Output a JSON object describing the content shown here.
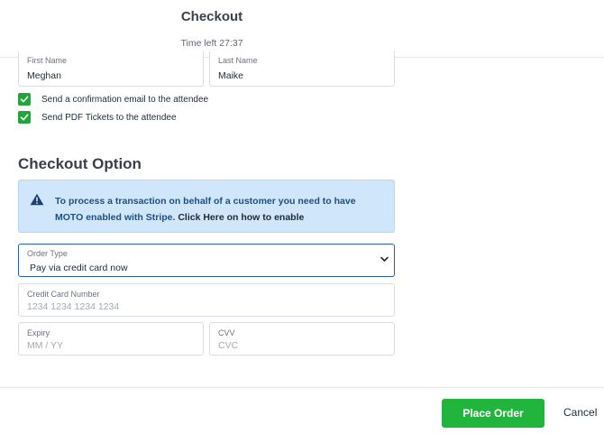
{
  "header": {
    "title": "Checkout",
    "timer": "Time left 27:37"
  },
  "attendee": {
    "first_name_label": "First Name",
    "first_name_value": "Meghan",
    "last_name_label": "Last Name",
    "last_name_value": "Maike",
    "options": [
      {
        "label": "Send a confirmation email to the attendee",
        "checked": true
      },
      {
        "label": "Send PDF Tickets to the attendee",
        "checked": true
      }
    ]
  },
  "checkout_option": {
    "section_title": "Checkout Option",
    "alert": {
      "text": "To process a transaction on behalf of a customer you need to have MOTO enabled with Stripe.",
      "link_text": "Click Here on how to enable",
      "icon": "warning-icon"
    },
    "order_type": {
      "label": "Order Type",
      "selected": "Pay via credit card now"
    },
    "credit_card": {
      "label": "Credit Card Number",
      "placeholder": "1234 1234 1234 1234"
    },
    "expiry": {
      "label": "Expiry",
      "placeholder": "MM / YY"
    },
    "cvv": {
      "label": "CVV",
      "placeholder": "CVC"
    }
  },
  "footer": {
    "place_order_label": "Place Order",
    "cancel_label": "Cancel"
  },
  "colors": {
    "accent_green": "#22b53d",
    "alert_bg": "#cfe6fb",
    "alert_text": "#1d4f86",
    "focus_border": "#2a5db0"
  }
}
